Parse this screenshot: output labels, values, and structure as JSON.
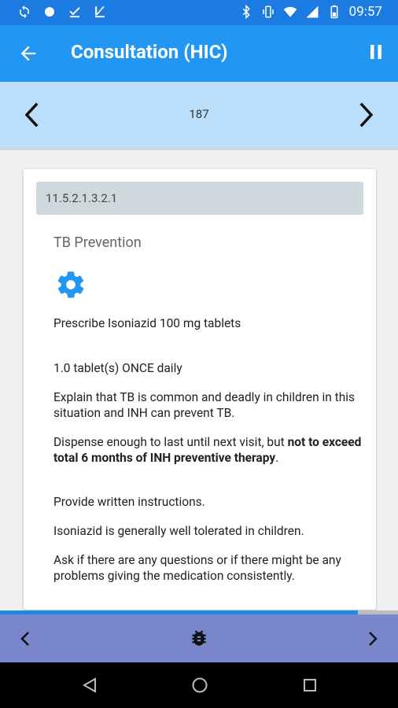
{
  "status_bar": {
    "time": "09:57",
    "left_icons": [
      "sync-icon",
      "circle-icon",
      "download-done-icon",
      "upload-icon"
    ],
    "right_icons": [
      "bluetooth-icon",
      "vibrate-icon",
      "wifi-icon",
      "signal-icon",
      "battery-icon"
    ]
  },
  "app_bar": {
    "title": "Consultation (HIC)"
  },
  "page_nav": {
    "page_number": "187"
  },
  "content": {
    "code": "11.5.2.1.3.2.1",
    "section_title": "TB Prevention",
    "prescription": "Prescribe Isoniazid 100 mg tablets",
    "dosage": "1.0 tablet(s) ONCE daily",
    "explain": "Explain that TB is common and deadly in children in this situation and INH can prevent TB.",
    "dispense_prefix": "Dispense enough to last until next visit, but ",
    "dispense_bold": "not to exceed total 6 months of INH preventive therapy",
    "dispense_suffix": ".",
    "instructions": "Provide written instructions.",
    "tolerated": "Isoniazid is generally well tolerated in children.",
    "questions": "Ask if there are any questions or if there might be any problems giving the medication consistently."
  },
  "progress": {
    "fraction": 0.9
  },
  "colors": {
    "status_bar": "#1b7be0",
    "app_bar": "#2196f3",
    "page_nav": "#bbdefb",
    "code_bar": "#cfd8dc",
    "gear": "#2196f3",
    "toolbar": "#7986cb",
    "progress": "#1e88e5"
  }
}
